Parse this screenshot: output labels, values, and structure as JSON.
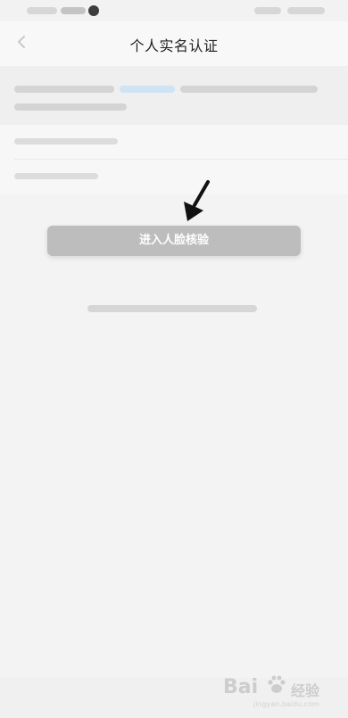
{
  "header": {
    "title": "个人实名认证"
  },
  "actions": {
    "face_verify_label": "进入人脸核验"
  },
  "watermark": {
    "brand": "Bai",
    "product": "经验",
    "url": "jingyan.baidu.com"
  }
}
